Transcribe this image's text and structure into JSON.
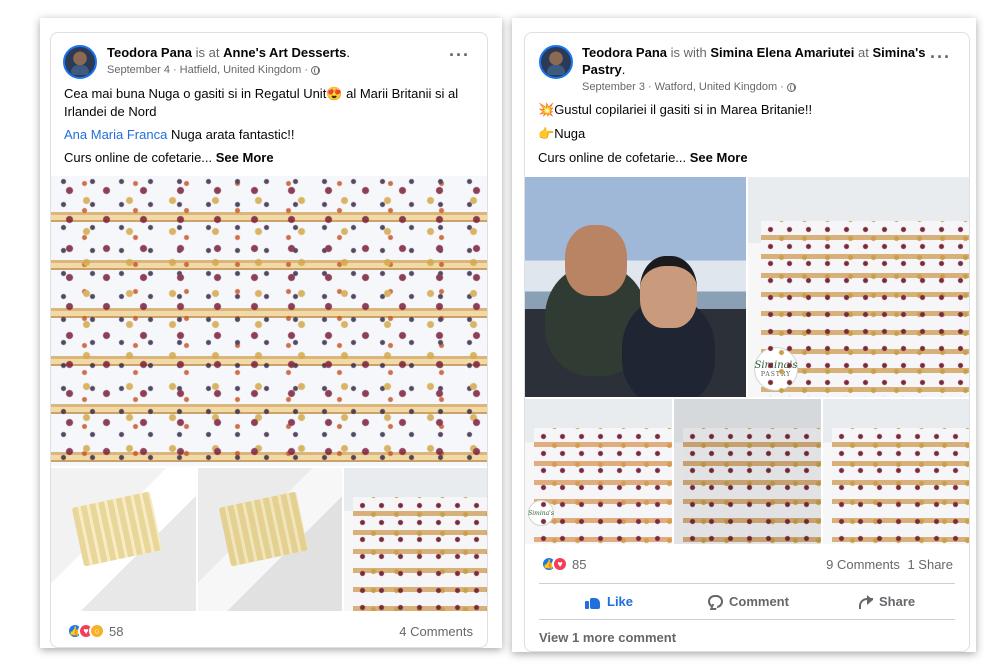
{
  "post_left": {
    "author": "Teodora Pana",
    "connector": "is at",
    "place": "Anne's Art Desserts",
    "date": "September 4",
    "location": "Hatfield, United Kingdom",
    "menu_icon": "more-horizontal-icon",
    "line1": "Cea mai buna Nuga o gasiti si in Regatul Unit",
    "line1_emoji": "😍",
    "line1_end": " al Marii Britanii si al",
    "line2": "Irlandei de Nord",
    "mention": "Ana Maria Franca",
    "mention_text": " Nuga arata fantastic!!",
    "course_text": "Curs online de cofetarie... ",
    "see_more": "See More",
    "images": [
      "nougat-wafer-bars",
      "nougat-in-box",
      "nougat-gift-box",
      "nougat-stack"
    ],
    "reaction_count": "58",
    "comments": "4 Comments"
  },
  "post_right": {
    "author": "Teodora Pana",
    "connector": "is with",
    "tagged": "Simina Elena Amariutei",
    "connector2": "at",
    "place": "Simina's",
    "place_line2": "Pastry",
    "date": "September 3",
    "location": "Watford, United Kingdom",
    "menu_icon": "more-horizontal-icon",
    "line1_emoji": "💥",
    "line1": "Gustul copilariei il gasiti si in Marea Britanie!!",
    "line2_emoji": "👉",
    "line2": "Nuga",
    "course_text": "Curs online de cofetarie... ",
    "see_more": "See More",
    "logo_text": "Simina's",
    "logo_sub": "PASTRY",
    "reaction_count": "85",
    "comments": "9 Comments",
    "shares": "1 Share",
    "actions": {
      "like": "Like",
      "comment": "Comment",
      "share": "Share"
    },
    "view_more": "View 1 more comment"
  },
  "colors": {
    "link": "#216fdb",
    "like_blue": "#1877f2",
    "love_red": "#f33e58",
    "muted": "#65676b"
  }
}
